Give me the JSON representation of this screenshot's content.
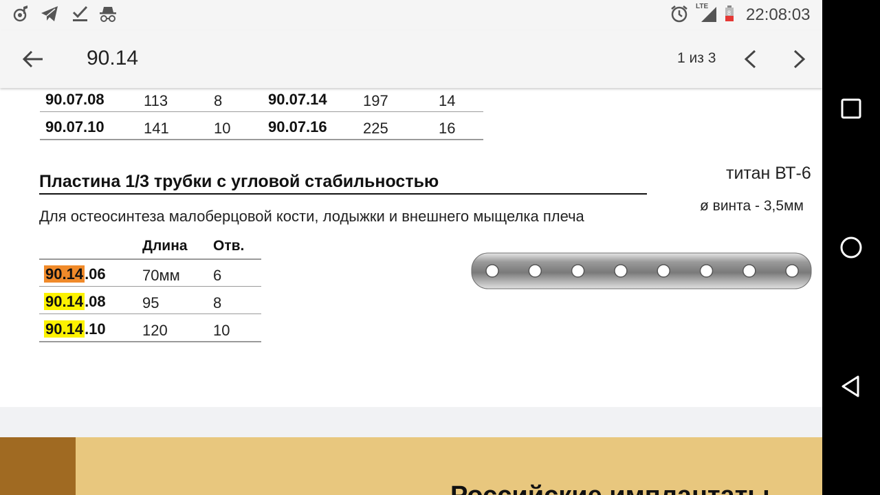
{
  "status_bar": {
    "time": "22:08:03",
    "network_label": "LTE",
    "battery_level": "8",
    "left_icons": [
      "music-note-icon",
      "telegram-icon",
      "download-done-icon",
      "incognito-icon"
    ],
    "right_icons": [
      "alarm-icon",
      "signal-icon",
      "battery-low-icon"
    ]
  },
  "app_bar": {
    "title": "90.14",
    "page_indicator": "1 из 3",
    "icons": [
      "arrow-left-icon",
      "chevron-left-icon",
      "chevron-right-icon"
    ]
  },
  "document": {
    "top_table": {
      "rows": [
        {
          "code_a": "90.07.08",
          "len_a": "113",
          "holes_a": "8",
          "code_b": "90.07.14",
          "len_b": "197",
          "holes_b": "14"
        },
        {
          "code_a": "90.07.10",
          "len_a": "141",
          "holes_a": "10",
          "code_b": "90.07.16",
          "len_b": "225",
          "holes_b": "16"
        }
      ]
    },
    "section": {
      "heading": "Пластина 1/3 трубки с угловой стабильностью",
      "material": "титан ВТ-6",
      "screw_diameter": "ø винта - 3,5мм",
      "description": "Для остеосинтеза малоберцовой кости, лодыжки и внешнего мыщелка плеча"
    },
    "plate_table": {
      "headers": [
        "Длина",
        "Отв."
      ],
      "rows": [
        {
          "code_highlight": "90.14",
          "code_rest": ".06",
          "length": "70мм",
          "holes": "6",
          "highlight_color": "#f08a2a"
        },
        {
          "code_highlight": "90.14",
          "code_rest": ".08",
          "length": "95",
          "holes": "8",
          "highlight_color": "#fcf200"
        },
        {
          "code_highlight": "90.14",
          "code_rest": ".10",
          "length": "120",
          "holes": "10",
          "highlight_color": "#fcf200"
        }
      ]
    },
    "plate_image": {
      "holes": 8
    }
  },
  "next_page_preview": {
    "heading": "Российские имплантаты"
  },
  "nav_bar": {
    "icons": [
      "recents-square-icon",
      "home-circle-icon",
      "back-triangle-icon"
    ]
  },
  "colors": {
    "highlight_orange": "#f08a2a",
    "highlight_yellow": "#fcf200",
    "preview_background": "#e8c77e",
    "preview_band": "#a06a22"
  }
}
